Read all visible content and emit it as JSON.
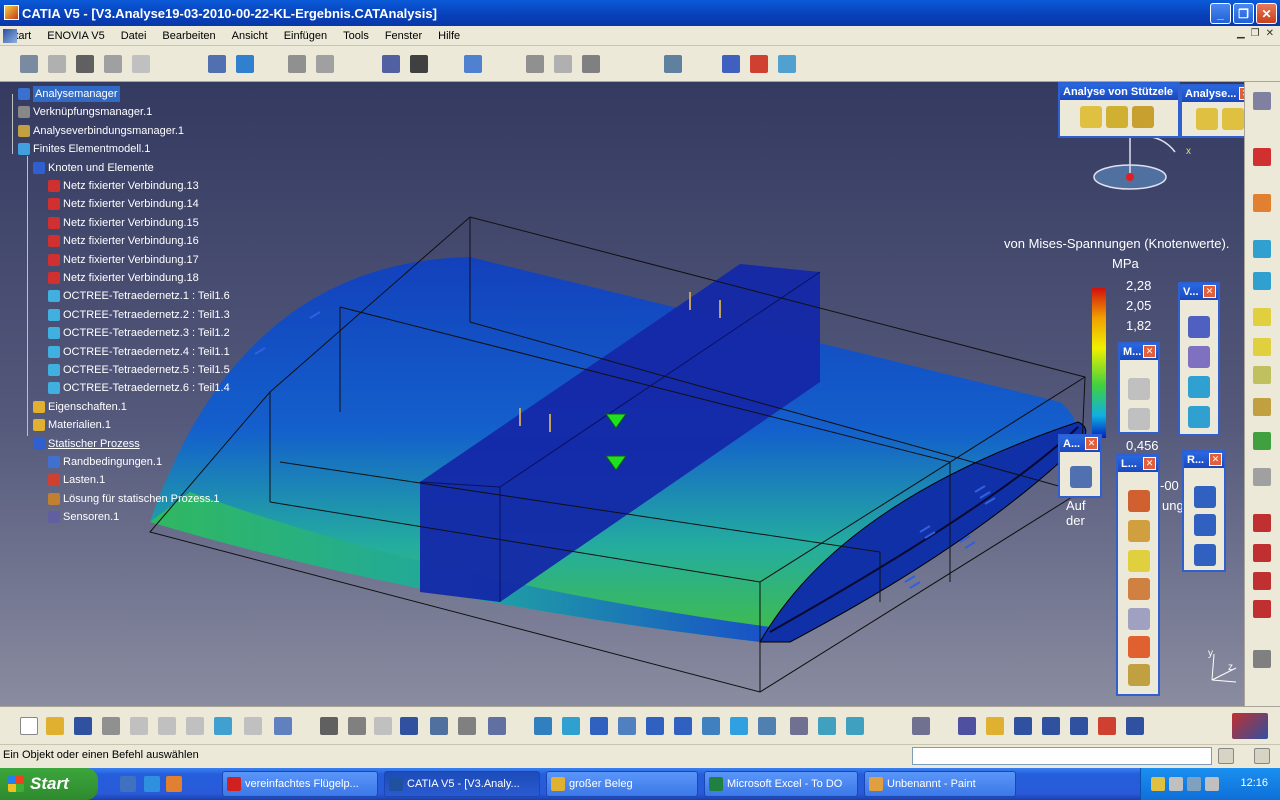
{
  "window": {
    "title": "CATIA V5 - [V3.Analyse19-03-2010-00-22-KL-Ergebnis.CATAnalysis]"
  },
  "menu": [
    "Start",
    "ENOVIA V5",
    "Datei",
    "Bearbeiten",
    "Ansicht",
    "Einfügen",
    "Tools",
    "Fenster",
    "Hilfe"
  ],
  "tree": [
    {
      "label": "Analysemanager",
      "depth": 0,
      "icon": "analysis-manager-icon",
      "color": "#3a70d0",
      "selected": true
    },
    {
      "label": "Verknüpfungsmanager.1",
      "depth": 0,
      "icon": "link-manager-icon",
      "color": "#888888"
    },
    {
      "label": "Analyseverbindungsmanager.1",
      "depth": 0,
      "icon": "connection-manager-icon",
      "color": "#c0a040"
    },
    {
      "label": "Finites Elementmodell.1",
      "depth": 0,
      "icon": "fem-model-icon",
      "color": "#40a0e0"
    },
    {
      "label": "Knoten und Elemente",
      "depth": 1,
      "icon": "nodes-elements-icon",
      "color": "#3060d0"
    },
    {
      "label": "Netz fixierter Verbindung.13",
      "depth": 2,
      "icon": "mesh-connection-icon",
      "color": "#d03030"
    },
    {
      "label": "Netz fixierter Verbindung.14",
      "depth": 2,
      "icon": "mesh-connection-icon",
      "color": "#d03030"
    },
    {
      "label": "Netz fixierter Verbindung.15",
      "depth": 2,
      "icon": "mesh-connection-icon",
      "color": "#d03030"
    },
    {
      "label": "Netz fixierter Verbindung.16",
      "depth": 2,
      "icon": "mesh-connection-icon",
      "color": "#d03030"
    },
    {
      "label": "Netz fixierter Verbindung.17",
      "depth": 2,
      "icon": "mesh-connection-icon",
      "color": "#d03030"
    },
    {
      "label": "Netz fixierter Verbindung.18",
      "depth": 2,
      "icon": "mesh-connection-icon",
      "color": "#d03030"
    },
    {
      "label": "OCTREE-Tetraedernetz.1 : Teil1.6",
      "depth": 2,
      "icon": "tetra-mesh-icon",
      "color": "#40b0e0"
    },
    {
      "label": "OCTREE-Tetraedernetz.2 : Teil1.3",
      "depth": 2,
      "icon": "tetra-mesh-icon",
      "color": "#40b0e0"
    },
    {
      "label": "OCTREE-Tetraedernetz.3 : Teil1.2",
      "depth": 2,
      "icon": "tetra-mesh-icon",
      "color": "#40b0e0"
    },
    {
      "label": "OCTREE-Tetraedernetz.4 : Teil1.1",
      "depth": 2,
      "icon": "tetra-mesh-icon",
      "color": "#40b0e0"
    },
    {
      "label": "OCTREE-Tetraedernetz.5 : Teil1.5",
      "depth": 2,
      "icon": "tetra-mesh-icon",
      "color": "#40b0e0"
    },
    {
      "label": "OCTREE-Tetraedernetz.6 : Teil1.4",
      "depth": 2,
      "icon": "tetra-mesh-icon",
      "color": "#40b0e0"
    },
    {
      "label": "Eigenschaften.1",
      "depth": 1,
      "icon": "folder-icon",
      "color": "#e0b030"
    },
    {
      "label": "Materialien.1",
      "depth": 1,
      "icon": "folder-icon",
      "color": "#e0b030"
    },
    {
      "label": "Statischer Prozess",
      "depth": 1,
      "icon": "static-process-icon",
      "color": "#3060d0"
    },
    {
      "label": "Randbedingungen.1",
      "depth": 2,
      "icon": "restraints-icon",
      "color": "#4070d0"
    },
    {
      "label": "Lasten.1",
      "depth": 2,
      "icon": "loads-icon",
      "color": "#d04030"
    },
    {
      "label": "Lösung für statischen Prozess.1",
      "depth": 2,
      "icon": "solution-icon",
      "color": "#c08030"
    },
    {
      "label": "Sensoren.1",
      "depth": 2,
      "icon": "sensors-icon",
      "color": "#6060a0"
    }
  ],
  "legend": {
    "title": "von Mises-Spannungen (Knotenwerte).",
    "unit": "MPa",
    "values": [
      "2,28",
      "2,05",
      "1,82"
    ],
    "low_value": "0,456",
    "partial_1": "-00",
    "partial_2": "Auf der",
    "partial_3": "ung"
  },
  "palettes": {
    "support_analysis": "Analyse von Stützele",
    "analysis": "Analyse...",
    "v": "V...",
    "m": "M...",
    "a": "A...",
    "l": "L...",
    "r": "R..."
  },
  "axes": {
    "x": "x",
    "y": "y",
    "z": "z"
  },
  "status": {
    "message": "Ein Objekt oder einen Befehl auswählen",
    "command_value": ""
  },
  "taskbar": {
    "start": "Start",
    "tasks": [
      {
        "label": "vereinfachtes Flügelp...",
        "icon": "opera-icon",
        "color": "#d02020",
        "active": false
      },
      {
        "label": "CATIA V5 - [V3.Analy...",
        "icon": "catia-icon",
        "color": "#2050a0",
        "active": true
      },
      {
        "label": "großer Beleg",
        "icon": "folder-icon",
        "color": "#e0b030",
        "active": false
      },
      {
        "label": "Microsoft Excel - To DO",
        "icon": "excel-icon",
        "color": "#208040",
        "active": false
      },
      {
        "label": "Unbenannt - Paint",
        "icon": "paint-icon",
        "color": "#e0a040",
        "active": false
      }
    ],
    "clock": "12:16"
  },
  "colors": {
    "xp_blue": "#245edb",
    "selection": "#316ac5"
  }
}
